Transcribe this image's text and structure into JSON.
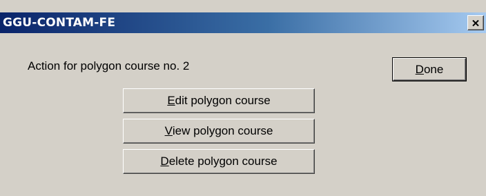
{
  "window": {
    "title": "GGU-CONTAM-FE",
    "close_icon": "close-x-icon"
  },
  "dialog": {
    "message": "Action for polygon course no. 2",
    "buttons": {
      "done": {
        "accel": "D",
        "rest": "one"
      },
      "edit": {
        "accel": "E",
        "rest": "dit polygon course"
      },
      "view": {
        "accel": "V",
        "rest": "iew polygon course"
      },
      "delete": {
        "accel": "D",
        "rest": "elete polygon course"
      }
    }
  },
  "colors": {
    "title_start": "#0a246a",
    "title_end": "#a6caf0",
    "face": "#d4d0c8"
  }
}
